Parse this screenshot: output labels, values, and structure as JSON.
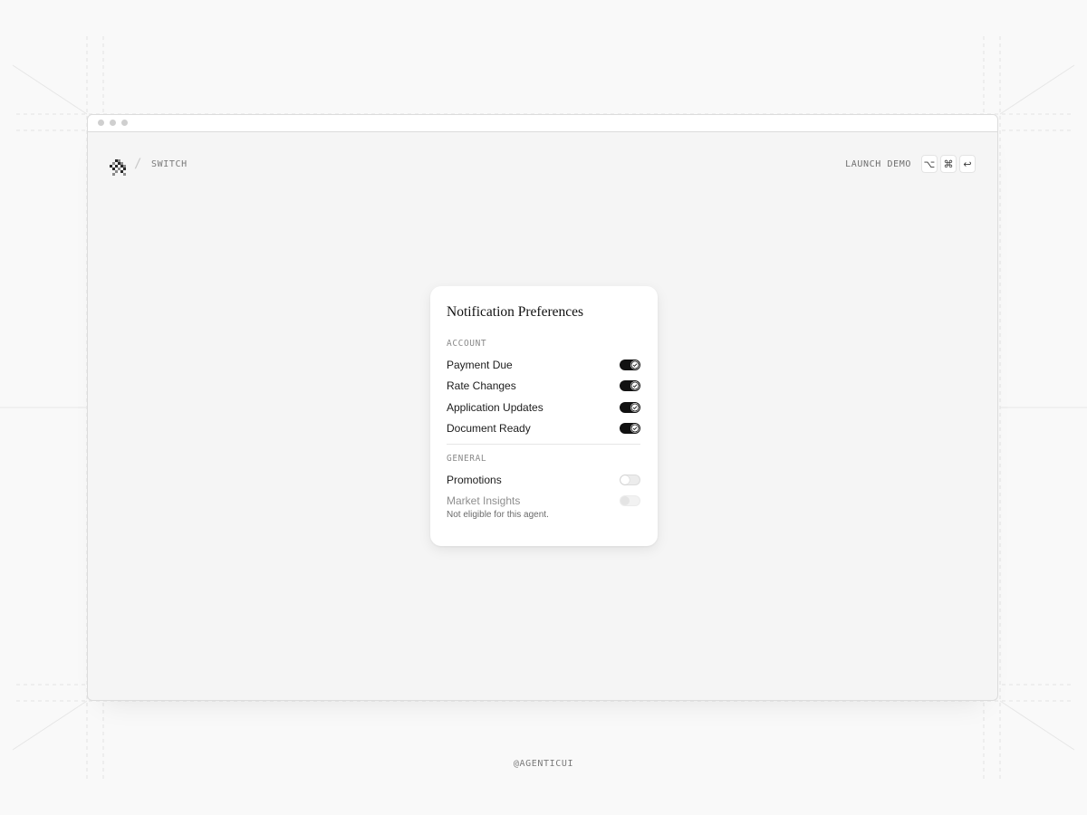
{
  "app": {
    "breadcrumb": "SWITCH",
    "launch_label": "LAUNCH DEMO",
    "shortcut_keys": [
      "⌥",
      "⌘",
      "↩"
    ]
  },
  "card": {
    "title": "Notification Preferences",
    "sections": [
      {
        "label": "ACCOUNT",
        "items": [
          {
            "label": "Payment Due",
            "state": "on"
          },
          {
            "label": "Rate Changes",
            "state": "on"
          },
          {
            "label": "Application Updates",
            "state": "on"
          },
          {
            "label": "Document Ready",
            "state": "on"
          }
        ]
      },
      {
        "label": "GENERAL",
        "items": [
          {
            "label": "Promotions",
            "state": "off"
          },
          {
            "label": "Market Insights",
            "state": "disabled",
            "helper": "Not eligible for this agent."
          }
        ]
      }
    ]
  },
  "footer": {
    "handle": "@AGENTICUI"
  },
  "colors": {
    "toggle_on": "#111111",
    "toggle_off": "#ececec",
    "window_bg": "#f5f5f5",
    "page_bg": "#f9f9f9"
  }
}
